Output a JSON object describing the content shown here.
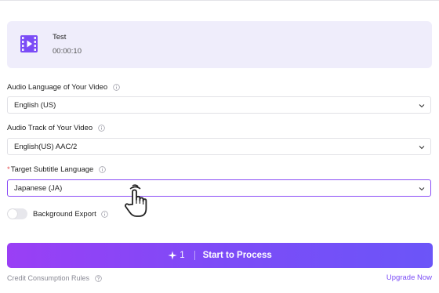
{
  "file": {
    "name": "Test",
    "duration": "00:00:10",
    "icon": "video-file-icon"
  },
  "audio_language": {
    "label": "Audio Language of Your Video",
    "value": "English (US)"
  },
  "audio_track": {
    "label": "Audio Track of Your Video",
    "value": "English(US) AAC/2"
  },
  "target_language": {
    "required_mark": "*",
    "label": "Target Subtitle Language",
    "value": "Japanese (JA)"
  },
  "background_export": {
    "label": "Background Export",
    "enabled": false
  },
  "process_button": {
    "credits": "1",
    "label": "Start to Process"
  },
  "footer": {
    "credit_rules": "Credit Consumption Rules",
    "upgrade": "Upgrade Now"
  },
  "colors": {
    "accent": "#8a4cf6",
    "card_bg": "#efedfb",
    "gradient_start": "#9a3ff5",
    "gradient_end": "#6b55f8",
    "required": "#e5484d"
  }
}
